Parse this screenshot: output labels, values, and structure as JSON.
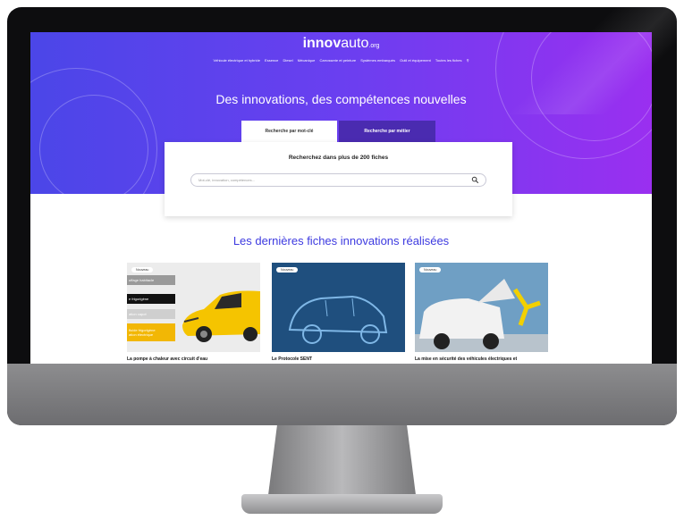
{
  "site": {
    "logo_bold": "innov",
    "logo_light": "auto",
    "logo_suffix": ".org"
  },
  "nav": {
    "items": [
      "Véhicule électrique et hybride",
      "Essence",
      "Diesel",
      "Mécanique",
      "Carrosserie et peinture",
      "Systèmes embarqués",
      "Outil et équipement",
      "Toutes les fiches"
    ]
  },
  "hero": {
    "headline": "Des innovations, des compétences nouvelles"
  },
  "search": {
    "tab_keyword": "Recherche par mot-clé",
    "tab_job": "Recherche par métier",
    "title": "Recherchez dans plus de 200 fiches",
    "placeholder": "Mot-clé, innovation, compétences..."
  },
  "section": {
    "title": "Les dernières fiches innovations réalisées"
  },
  "cards": [
    {
      "badge": "Nouveau",
      "title": "La pompe à chaleur avec circuit d'eau",
      "chips": [
        "uffage habitacle",
        "e frigorigène",
        "ation capot",
        "fluide frigorigène\nation électrique"
      ]
    },
    {
      "badge": "Nouveau",
      "title": "Le Protocole SENT"
    },
    {
      "badge": "Nouveau",
      "title": "La mise en sécurité des véhicules électriques et"
    }
  ],
  "colors": {
    "hero_start": "#4b46e8",
    "hero_end": "#9a2ff0",
    "accent": "#3d3ae0",
    "tab_active_bg": "#4a2bb0"
  }
}
